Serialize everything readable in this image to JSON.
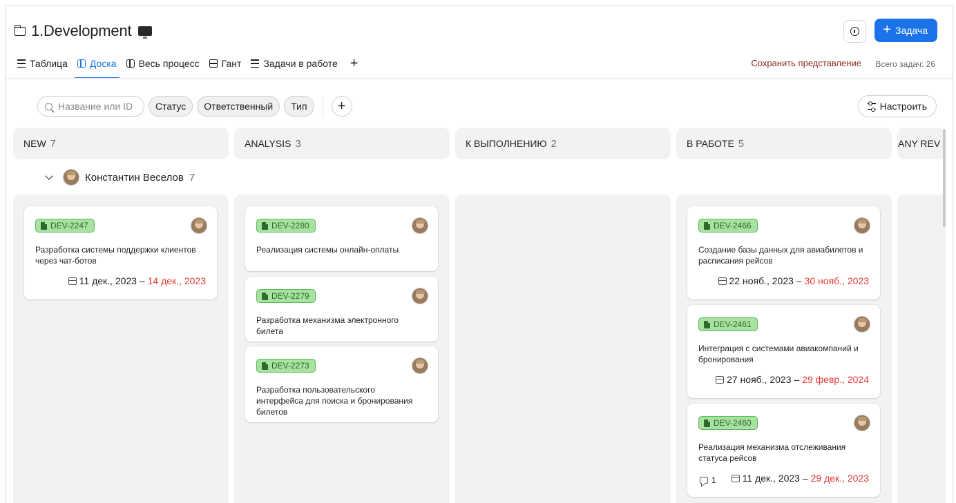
{
  "project": {
    "title": "1.Development",
    "icon": "monitor-icon"
  },
  "header": {
    "add_task_label": "Задача",
    "info_icon": "info-icon"
  },
  "tabs": [
    {
      "label": "Таблица",
      "icon": "lines-icon",
      "active": false
    },
    {
      "label": "Доска",
      "icon": "board-icon",
      "active": true
    },
    {
      "label": "Весь процесс",
      "icon": "board-icon",
      "active": false
    },
    {
      "label": "Гант",
      "icon": "gantt-icon",
      "active": false
    },
    {
      "label": "Задачи в работе",
      "icon": "lines-icon",
      "active": false
    }
  ],
  "save_view_label": "Сохранить представление",
  "total_tasks": "Всего задач: 26",
  "filters": {
    "search_placeholder": "Название или ID",
    "chips": [
      "Статус",
      "Ответственный",
      "Тип"
    ],
    "configure_label": "Настроить"
  },
  "columns": [
    {
      "name": "NEW",
      "count": "7"
    },
    {
      "name": "ANALYSIS",
      "count": "3"
    },
    {
      "name": "К ВЫПОЛНЕНИЮ",
      "count": "2"
    },
    {
      "name": "В РАБОТЕ",
      "count": "5"
    },
    {
      "name": "ANY REV",
      "count": ""
    }
  ],
  "group": {
    "name": "Константин Веселов",
    "count": "7"
  },
  "cards": {
    "new": [
      {
        "id": "DEV-2247",
        "title": "Разработка системы поддержки клиентов через чат-ботов",
        "date_start": "11 дек., 2023 –",
        "date_end": "14 дек., 2023"
      }
    ],
    "analysis": [
      {
        "id": "DEV-2280",
        "title": "Реализация системы онлайн-оплаты"
      },
      {
        "id": "DEV-2279",
        "title": "Разработка механизма электронного билета"
      },
      {
        "id": "DEV-2273",
        "title": "Разработка пользовательского интерфейса для поиска и бронирования билетов"
      }
    ],
    "in_progress": [
      {
        "id": "DEV-2466",
        "title": "Создание базы данных для авиабилетов и расписания рейсов",
        "date_start": "22 нояб., 2023 –",
        "date_end": "30 нояб., 2023"
      },
      {
        "id": "DEV-2461",
        "title": "Интеграция с системами авиакомпаний и бронирования",
        "date_start": "27 нояб., 2023 –",
        "date_end": "29 февр., 2024"
      },
      {
        "id": "DEV-2460",
        "title": "Реализация механизма отслеживания статуса рейсов",
        "comments": "1",
        "date_start": "11 дек., 2023 –",
        "date_end": "29 дек., 2023"
      }
    ]
  },
  "colors": {
    "accent": "#1a73e8",
    "badge_bg": "#a8e2a0",
    "badge_text": "#2d6a2d",
    "overdue": "#e53935",
    "save_view": "#8a2b1a"
  }
}
